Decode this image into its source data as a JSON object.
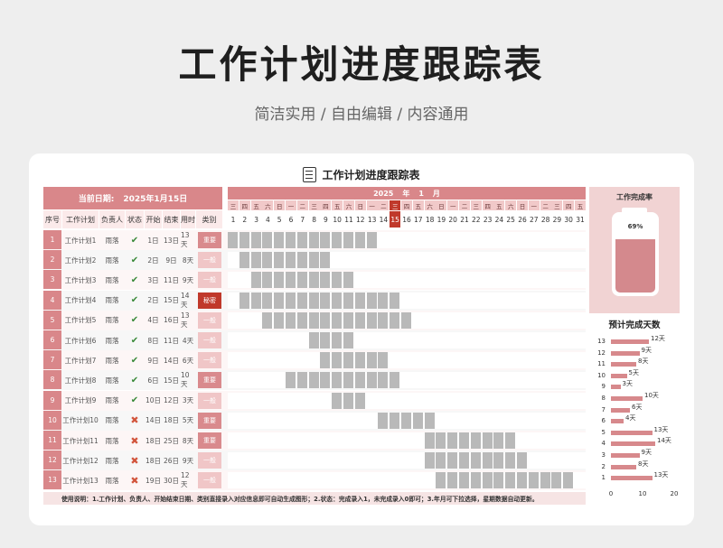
{
  "hero": {
    "title": "工作计划进度跟踪表",
    "subtitle": "简洁实用 / 自由编辑 / 内容通用"
  },
  "sheet": {
    "title": "工作计划进度跟踪表",
    "current_date_label": "当前日期:",
    "current_date_value": "2025年1月15日",
    "columns": [
      "序号",
      "工作计划",
      "负责人",
      "状态",
      "开始",
      "结束",
      "用时",
      "类别"
    ],
    "year": "2025",
    "year_unit": "年",
    "month": "1",
    "month_unit": "月",
    "today_day": 15,
    "footnote": "使用说明：1.工作计划、负责人、开始结束日期、类别直接录入对应信息即可自动生成图形；2.状态：完成录入1，未完成录入0即可；3.年月可下拉选择，星期数据自动更新。",
    "weekdays": [
      "三",
      "四",
      "五",
      "六",
      "日",
      "一",
      "二",
      "三",
      "四",
      "五",
      "六",
      "日",
      "一",
      "二",
      "三",
      "四",
      "五",
      "六",
      "日",
      "一",
      "二",
      "三",
      "四",
      "五",
      "六",
      "日",
      "一",
      "二",
      "三",
      "四",
      "五"
    ],
    "days": [
      1,
      2,
      3,
      4,
      5,
      6,
      7,
      8,
      9,
      10,
      11,
      12,
      13,
      14,
      15,
      16,
      17,
      18,
      19,
      20,
      21,
      22,
      23,
      24,
      25,
      26,
      27,
      28,
      29,
      30,
      31
    ]
  },
  "tasks": [
    {
      "no": "1",
      "name": "工作计划1",
      "owner": "雨落",
      "done": true,
      "start": 1,
      "start_label": "1日",
      "end": 13,
      "end_label": "13日",
      "duration": "13天",
      "category": "重要"
    },
    {
      "no": "2",
      "name": "工作计划2",
      "owner": "雨落",
      "done": true,
      "start": 2,
      "start_label": "2日",
      "end": 9,
      "end_label": "9日",
      "duration": "8天",
      "category": "一般"
    },
    {
      "no": "3",
      "name": "工作计划3",
      "owner": "雨落",
      "done": true,
      "start": 3,
      "start_label": "3日",
      "end": 11,
      "end_label": "11日",
      "duration": "9天",
      "category": "一般"
    },
    {
      "no": "4",
      "name": "工作计划4",
      "owner": "雨落",
      "done": true,
      "start": 2,
      "start_label": "2日",
      "end": 15,
      "end_label": "15日",
      "duration": "14天",
      "category": "秘密"
    },
    {
      "no": "5",
      "name": "工作计划5",
      "owner": "雨落",
      "done": true,
      "start": 4,
      "start_label": "4日",
      "end": 16,
      "end_label": "16日",
      "duration": "13天",
      "category": "一般"
    },
    {
      "no": "6",
      "name": "工作计划6",
      "owner": "雨落",
      "done": true,
      "start": 8,
      "start_label": "8日",
      "end": 11,
      "end_label": "11日",
      "duration": "4天",
      "category": "一般"
    },
    {
      "no": "7",
      "name": "工作计划7",
      "owner": "雨落",
      "done": true,
      "start": 9,
      "start_label": "9日",
      "end": 14,
      "end_label": "14日",
      "duration": "6天",
      "category": "一般"
    },
    {
      "no": "8",
      "name": "工作计划8",
      "owner": "雨落",
      "done": true,
      "start": 6,
      "start_label": "6日",
      "end": 15,
      "end_label": "15日",
      "duration": "10天",
      "category": "重要"
    },
    {
      "no": "9",
      "name": "工作计划9",
      "owner": "雨落",
      "done": true,
      "start": 10,
      "start_label": "10日",
      "end": 12,
      "end_label": "12日",
      "duration": "3天",
      "category": "一般"
    },
    {
      "no": "10",
      "name": "工作计划10",
      "owner": "雨落",
      "done": false,
      "start": 14,
      "start_label": "14日",
      "end": 18,
      "end_label": "18日",
      "duration": "5天",
      "category": "重要"
    },
    {
      "no": "11",
      "name": "工作计划11",
      "owner": "雨落",
      "done": false,
      "start": 18,
      "start_label": "18日",
      "end": 25,
      "end_label": "25日",
      "duration": "8天",
      "category": "重要"
    },
    {
      "no": "12",
      "name": "工作计划12",
      "owner": "雨落",
      "done": false,
      "start": 18,
      "start_label": "18日",
      "end": 26,
      "end_label": "26日",
      "duration": "9天",
      "category": "一般"
    },
    {
      "no": "13",
      "name": "工作计划13",
      "owner": "雨落",
      "done": false,
      "start": 19,
      "start_label": "19日",
      "end": 30,
      "end_label": "30日",
      "duration": "12天",
      "category": "一般"
    }
  ],
  "category_colors": {
    "重要": "#d98a8d",
    "一般": "#f0c6c7",
    "秘密": "#c0392b"
  },
  "completion": {
    "label": "工作完成率",
    "percent_label": "69%",
    "fraction": 0.69
  },
  "chart_data": {
    "type": "bar",
    "orientation": "horizontal",
    "title": "预计完成天数",
    "categories": [
      "13",
      "12",
      "11",
      "10",
      "9",
      "8",
      "7",
      "6",
      "5",
      "4",
      "3",
      "2",
      "1"
    ],
    "values": [
      12,
      9,
      8,
      5,
      3,
      10,
      6,
      4,
      13,
      14,
      9,
      8,
      13
    ],
    "labels": [
      "12天",
      "9天",
      "8天",
      "5天",
      "3天",
      "10天",
      "6天",
      "4天",
      "13天",
      "14天",
      "9天",
      "8天",
      "13天"
    ],
    "xlim": [
      0,
      20
    ],
    "xticks": [
      "0",
      "10",
      "20"
    ],
    "color": "#d7898c"
  }
}
